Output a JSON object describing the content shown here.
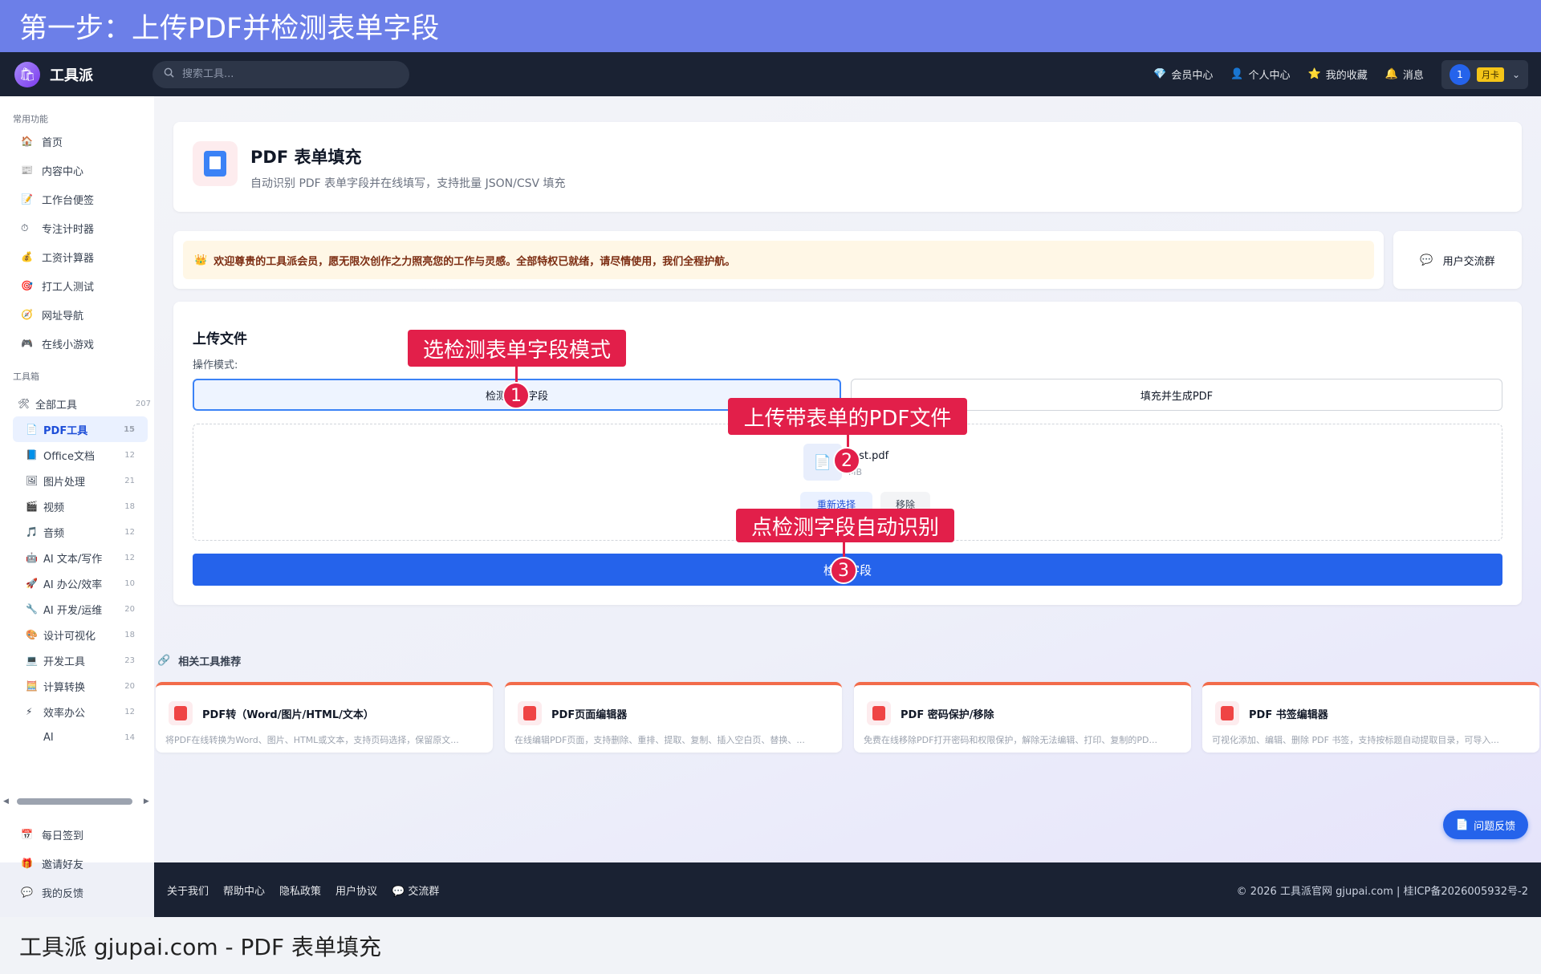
{
  "captions": {
    "top": "第一步：上传PDF并检测表单字段",
    "bottom": "工具派 gjupai.com - PDF 表单填充"
  },
  "navbar": {
    "logo_text": "工具派",
    "search_placeholder": "搜索工具...",
    "links": [
      {
        "icon": "diamond-icon",
        "glyph": "💎",
        "label": "会员中心"
      },
      {
        "icon": "person-icon",
        "glyph": "👤",
        "label": "个人中心"
      },
      {
        "icon": "star-icon",
        "glyph": "⭐",
        "label": "我的收藏"
      },
      {
        "icon": "bell-icon",
        "glyph": "🔔",
        "label": "消息"
      }
    ],
    "avatar_text": "1",
    "vip_badge": "月卡"
  },
  "sidebar": {
    "section_common": "常用功能",
    "common": [
      {
        "glyph": "🏠",
        "label": "首页"
      },
      {
        "glyph": "📰",
        "label": "内容中心"
      },
      {
        "glyph": "📝",
        "label": "工作台便签"
      },
      {
        "glyph": "⏱",
        "label": "专注计时器"
      },
      {
        "glyph": "💰",
        "label": "工资计算器"
      },
      {
        "glyph": "🎯",
        "label": "打工人测试"
      },
      {
        "glyph": "🧭",
        "label": "网址导航"
      },
      {
        "glyph": "🎮",
        "label": "在线小游戏"
      }
    ],
    "section_tools": "工具箱",
    "all_tools": {
      "glyph": "🛠",
      "label": "全部工具",
      "count": "207"
    },
    "tools": [
      {
        "glyph": "📄",
        "label": "PDF工具",
        "count": "15"
      },
      {
        "glyph": "📘",
        "label": "Office文档",
        "count": "12"
      },
      {
        "glyph": "🖼",
        "label": "图片处理",
        "count": "21"
      },
      {
        "glyph": "🎬",
        "label": "视频",
        "count": "18"
      },
      {
        "glyph": "🎵",
        "label": "音频",
        "count": "12"
      },
      {
        "glyph": "🤖",
        "label": "AI 文本/写作",
        "count": "12"
      },
      {
        "glyph": "🚀",
        "label": "AI 办公/效率",
        "count": "10"
      },
      {
        "glyph": "🔧",
        "label": "AI 开发/运维",
        "count": "20"
      },
      {
        "glyph": "🎨",
        "label": "设计可视化",
        "count": "18"
      },
      {
        "glyph": "💻",
        "label": "开发工具",
        "count": "23"
      },
      {
        "glyph": "🧮",
        "label": "计算转换",
        "count": "20"
      },
      {
        "glyph": "⚡",
        "label": "效率办公",
        "count": "12"
      },
      {
        "glyph": "",
        "label": "AI",
        "count": "14"
      }
    ],
    "bottom": [
      {
        "glyph": "📅",
        "label": "每日签到"
      },
      {
        "glyph": "🎁",
        "label": "邀请好友"
      },
      {
        "glyph": "💬",
        "label": "我的反馈"
      }
    ]
  },
  "header": {
    "title": "PDF 表单填充",
    "subtitle": "自动识别 PDF 表单字段并在线填写，支持批量 JSON/CSV 填充"
  },
  "notice": {
    "glyph": "👑",
    "text": "欢迎尊贵的工具派会员，愿无限次创作之力照亮您的工作与灵感。全部特权已就绪，请尽情使用，我们全程护航。"
  },
  "community": {
    "glyph": "💬",
    "label": "用户交流群"
  },
  "upload": {
    "title": "上传文件",
    "mode_label": "操作模式:",
    "mode_detect": "检测表单字段",
    "mode_fill": "填充并生成PDF",
    "file_name": "test.pdf",
    "file_size": "MB",
    "reselect": "重新选择",
    "remove": "移除",
    "detect_button": "检测字段"
  },
  "related": {
    "title": "相关工具推荐",
    "items": [
      {
        "name": "PDF转（Word/图片/HTML/文本）",
        "desc": "将PDF在线转换为Word、图片、HTML或文本，支持页码选择，保留原文..."
      },
      {
        "name": "PDF页面编辑器",
        "desc": "在线编辑PDF页面，支持删除、重排、提取、复制、插入空白页、替换、..."
      },
      {
        "name": "PDF 密码保护/移除",
        "desc": "免费在线移除PDF打开密码和权限保护，解除无法编辑、打印、复制的PD..."
      },
      {
        "name": "PDF 书签编辑器",
        "desc": "可视化添加、编辑、删除 PDF 书签，支持按标题自动提取目录，可导入..."
      }
    ]
  },
  "feedback": {
    "glyph": "📄",
    "label": "问题反馈"
  },
  "footer": {
    "links": [
      "关于我们",
      "帮助中心",
      "隐私政策",
      "用户协议",
      "💬 交流群"
    ],
    "copyright": "© 2026 工具派官网 gjupai.com | 桂ICP备2026005932号-2"
  },
  "annotations": [
    {
      "label": "选检测表单字段模式",
      "num": "1"
    },
    {
      "label": "上传带表单的PDF文件",
      "num": "2"
    },
    {
      "label": "点检测字段自动识别",
      "num": "3"
    }
  ],
  "colors": {
    "accent": "#2563eb",
    "callout": "#e21f4a",
    "banner": "#6c7fe8",
    "nav": "#1a2233"
  }
}
